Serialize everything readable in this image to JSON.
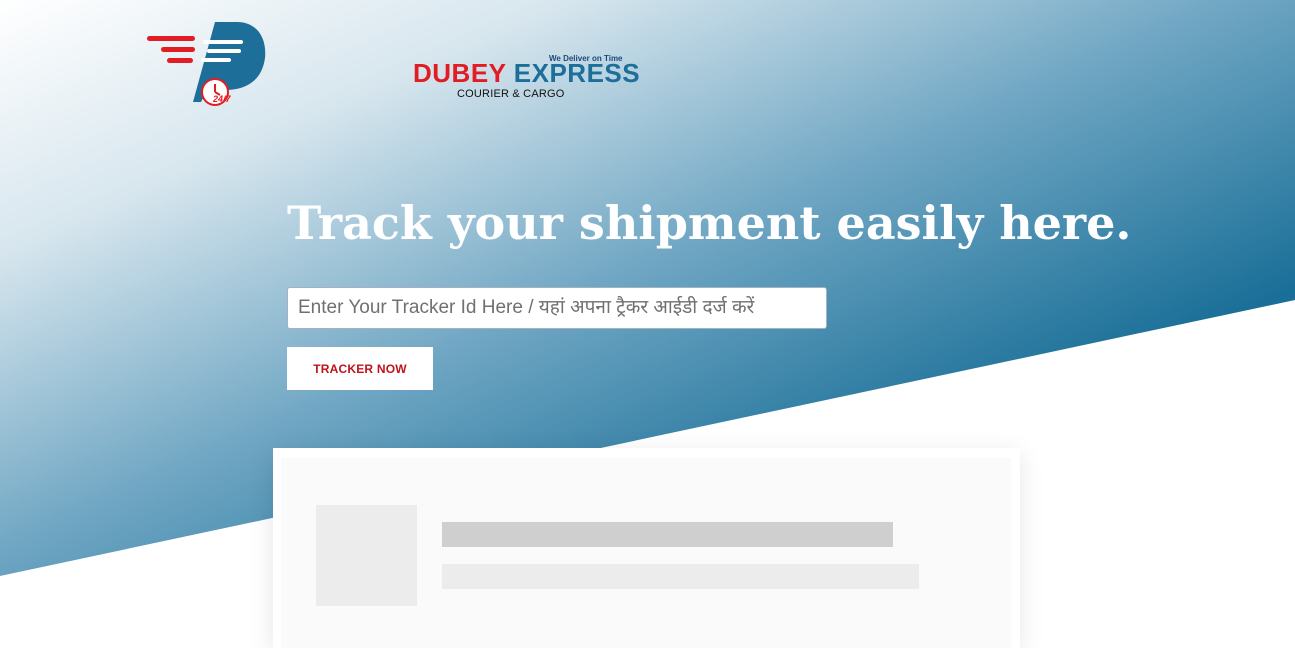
{
  "brand": {
    "tagline": "We Deliver on Time",
    "name_part1": "DUBEY",
    "name_part2": "EXPRESS",
    "subtitle": "COURIER & CARGO",
    "badge": "24/7"
  },
  "hero": {
    "headline": "Track your shipment easily here."
  },
  "search": {
    "placeholder": "Enter Your Tracker Id Here / यहां अपना ट्रैकर आईडी दर्ज करें",
    "value": ""
  },
  "actions": {
    "track_label": "TRACKER NOW"
  },
  "colors": {
    "brand_red": "#e31b23",
    "brand_blue": "#1d6e98",
    "hero_gradient_dark": "#0f6690",
    "hero_gradient_light": "#dfe9ef"
  },
  "icons": {
    "logo_mark": "speed-lines-d-mark",
    "clock": "clock-24-7-icon"
  }
}
